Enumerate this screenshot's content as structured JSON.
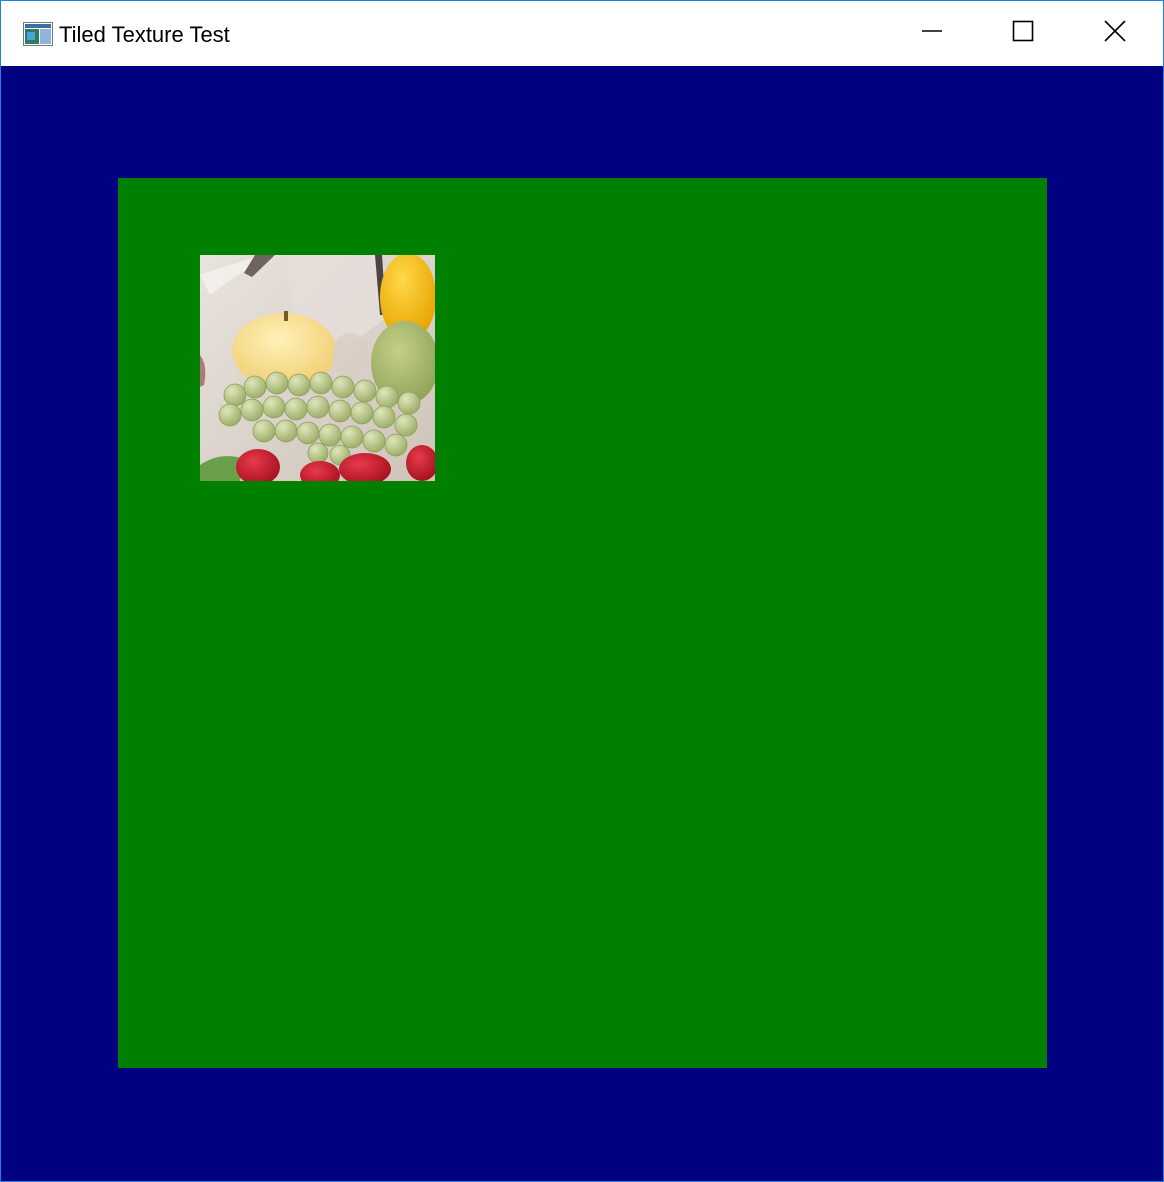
{
  "window": {
    "title": "Tiled Texture Test",
    "icon": "app-window-icon",
    "controls": {
      "minimize_icon": "minimize-icon",
      "maximize_icon": "maximize-icon",
      "close_icon": "close-icon"
    }
  },
  "colors": {
    "clear_color": "#000080",
    "quad_color": "#008000",
    "title_bar": "#ffffff",
    "window_border": "#1883d7"
  },
  "texture": {
    "subject": "fruit-bowl-texture"
  }
}
